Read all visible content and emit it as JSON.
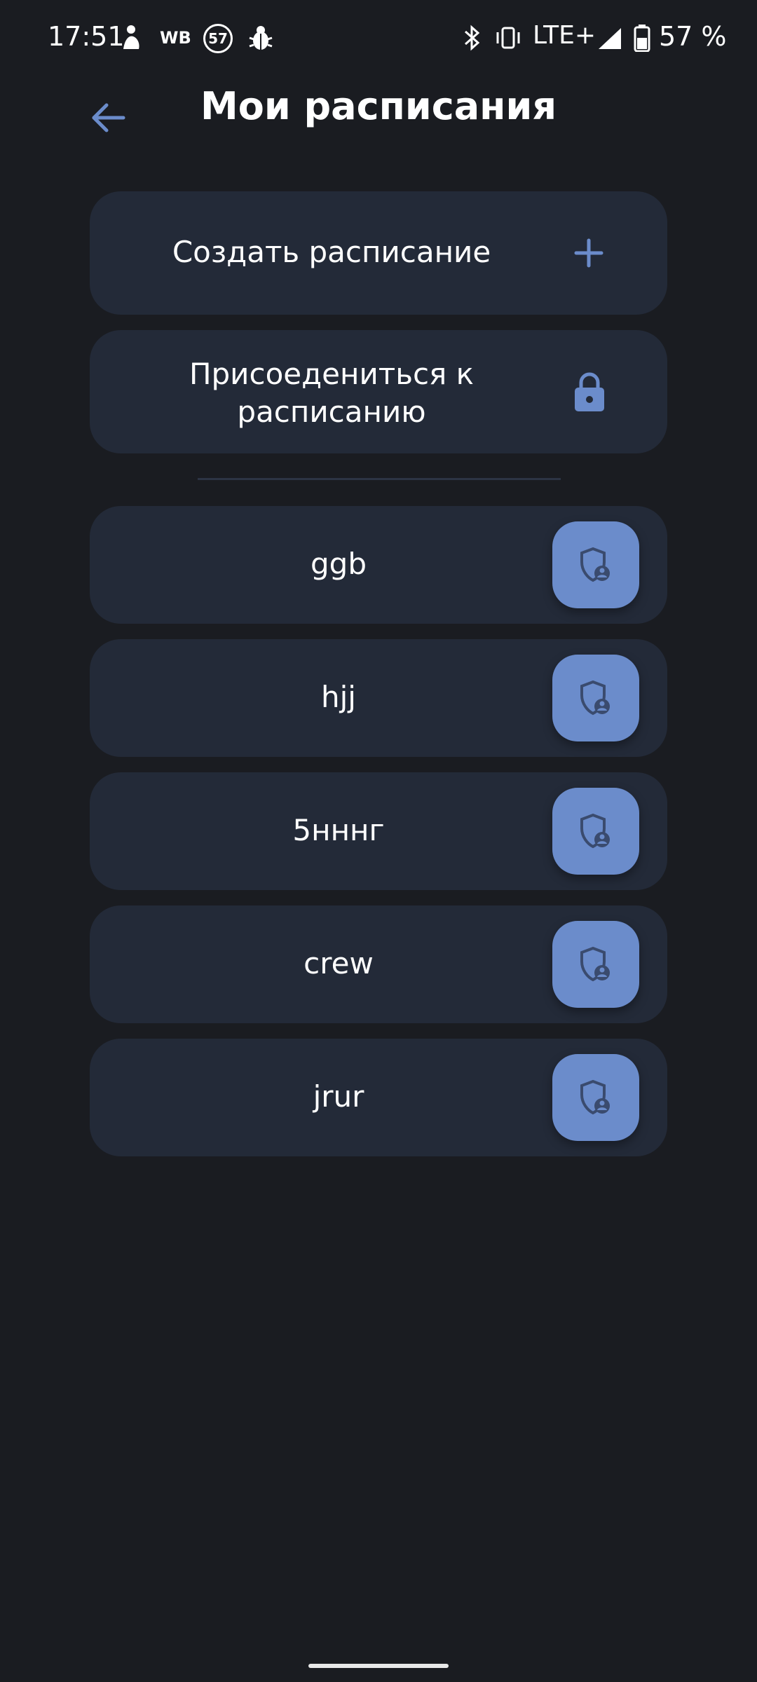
{
  "status_bar": {
    "time": "17:51",
    "wb": "WB",
    "badge": "57",
    "network": "LTE+",
    "battery": "57 %"
  },
  "header": {
    "title": "Мои расписания",
    "back_icon": "arrow-left-icon"
  },
  "actions": {
    "create_label": "Создать расписание",
    "create_icon": "plus-icon",
    "join_label": "Присоедениться к расписанию",
    "join_icon": "lock-icon"
  },
  "schedules": [
    {
      "name": "ggb"
    },
    {
      "name": "hjj"
    },
    {
      "name": "5нннг"
    },
    {
      "name": "crew"
    },
    {
      "name": "jrur"
    }
  ],
  "colors": {
    "background": "#1a1c21",
    "card": "#232a38",
    "accent": "#6b8ccb"
  }
}
